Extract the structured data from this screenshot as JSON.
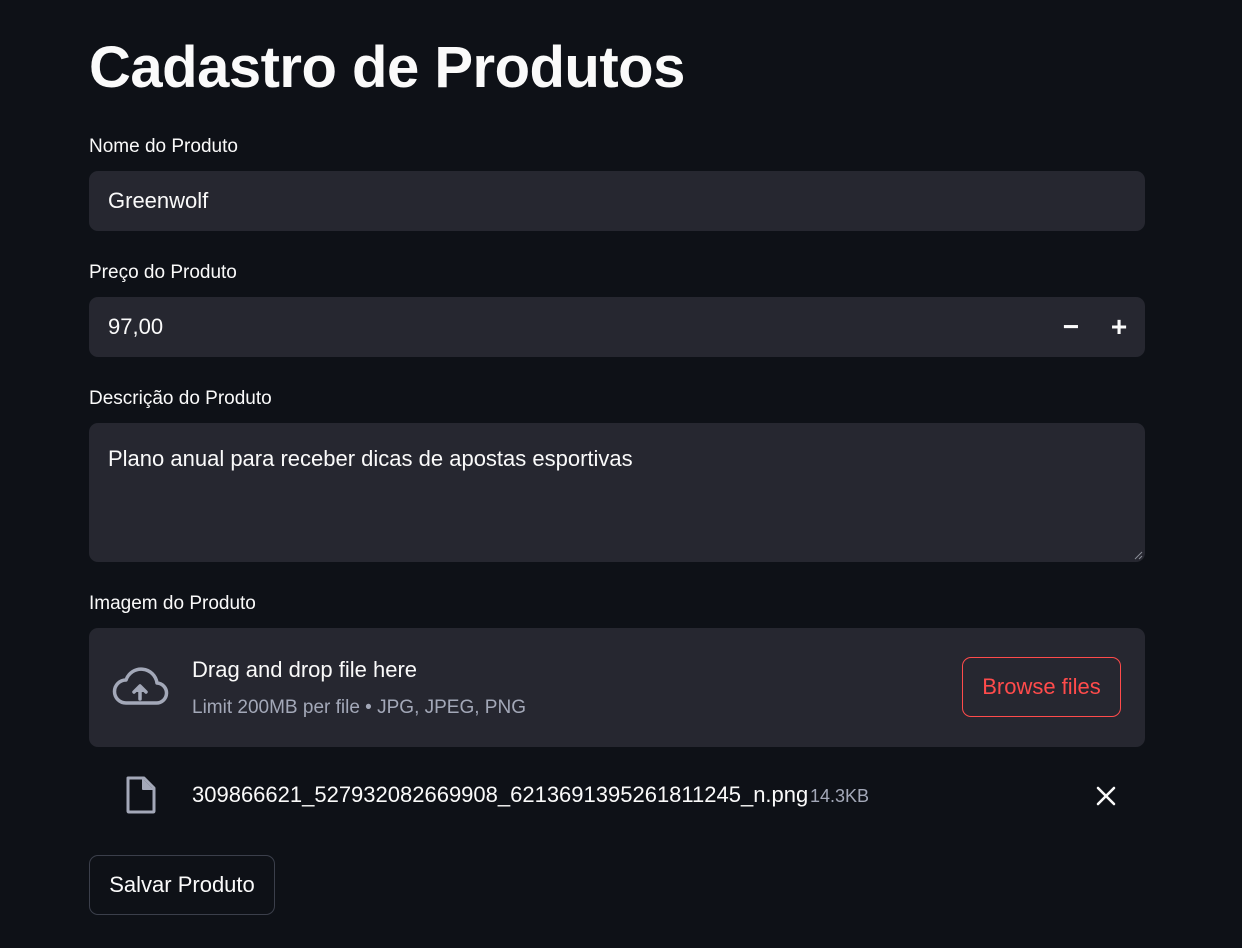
{
  "page": {
    "title": "Cadastro de Produtos"
  },
  "form": {
    "name": {
      "label": "Nome do Produto",
      "value": "Greenwolf"
    },
    "price": {
      "label": "Preço do Produto",
      "value": "97,00",
      "decrement_symbol": "−",
      "increment_symbol": "+"
    },
    "description": {
      "label": "Descrição do Produto",
      "value": "Plano anual para receber dicas de apostas esportivas"
    },
    "image": {
      "label": "Imagem do Produto",
      "dropzone": {
        "icon": "cloud-upload-icon",
        "title": "Drag and drop file here",
        "limits": "Limit 200MB per file • JPG, JPEG, PNG",
        "browse_label": "Browse files"
      },
      "uploaded_file": {
        "icon": "file-icon",
        "name": "309866621_527932082669908_6213691395261811245_n.png",
        "size": "14.3KB",
        "remove_icon": "close-icon"
      }
    },
    "submit_label": "Salvar Produto"
  },
  "colors": {
    "background": "#0e1117",
    "input_background": "#262730",
    "text": "#fafafa",
    "muted_text": "#a3a8b8",
    "accent": "#ff4b4b"
  }
}
